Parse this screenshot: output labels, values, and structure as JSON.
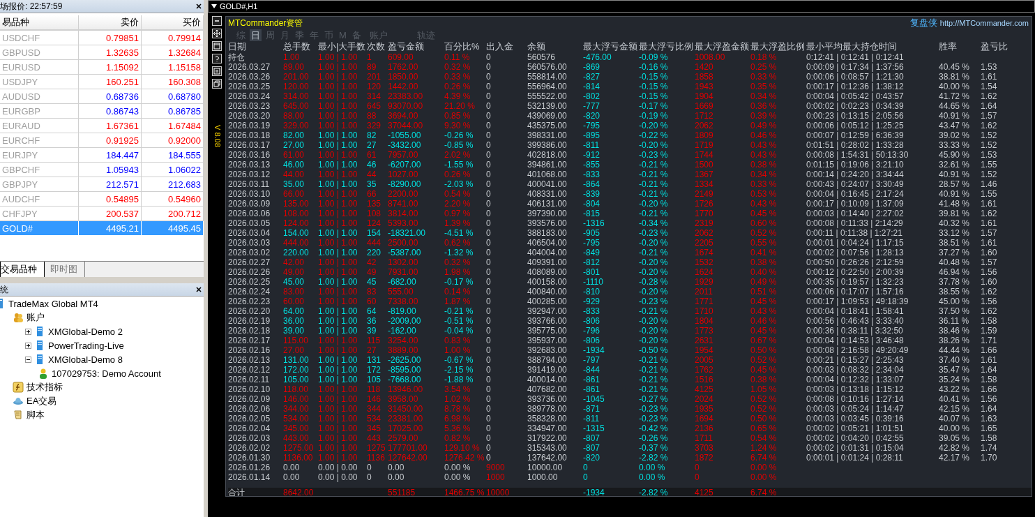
{
  "market_watch": {
    "title": "场报价: 22:57:59",
    "columns": [
      "易品种",
      "卖价",
      "买价"
    ],
    "rows": [
      {
        "symbol": "USDCHF",
        "bid": "0.79851",
        "ask": "0.79914",
        "color": "#ff0000",
        "selected": false
      },
      {
        "symbol": "GBPUSD",
        "bid": "1.32635",
        "ask": "1.32684",
        "color": "#ff0000",
        "selected": false
      },
      {
        "symbol": "EURUSD",
        "bid": "1.15092",
        "ask": "1.15158",
        "color": "#ff0000",
        "selected": false
      },
      {
        "symbol": "USDJPY",
        "bid": "160.251",
        "ask": "160.308",
        "color": "#ff0000",
        "selected": false
      },
      {
        "symbol": "AUDUSD",
        "bid": "0.68736",
        "ask": "0.68780",
        "color": "#0000ff",
        "selected": false
      },
      {
        "symbol": "EURGBP",
        "bid": "0.86743",
        "ask": "0.86785",
        "color": "#0000ff",
        "selected": false
      },
      {
        "symbol": "EURAUD",
        "bid": "1.67361",
        "ask": "1.67484",
        "color": "#ff0000",
        "selected": false
      },
      {
        "symbol": "EURCHF",
        "bid": "0.91925",
        "ask": "0.92000",
        "color": "#ff0000",
        "selected": false
      },
      {
        "symbol": "EURJPY",
        "bid": "184.447",
        "ask": "184.555",
        "color": "#0000ff",
        "selected": false
      },
      {
        "symbol": "GBPCHF",
        "bid": "1.05943",
        "ask": "1.06022",
        "color": "#0000ff",
        "selected": false
      },
      {
        "symbol": "GBPJPY",
        "bid": "212.571",
        "ask": "212.683",
        "color": "#0000ff",
        "selected": false
      },
      {
        "symbol": "AUDCHF",
        "bid": "0.54895",
        "ask": "0.54960",
        "color": "#ff0000",
        "selected": false
      },
      {
        "symbol": "CHFJPY",
        "bid": "200.537",
        "ask": "200.712",
        "color": "#ff0000",
        "selected": false
      },
      {
        "symbol": "GOLD#",
        "bid": "4495.21",
        "ask": "4495.45",
        "selected": true
      }
    ],
    "tabs": [
      {
        "label": "交易品种",
        "selected": true
      },
      {
        "label": "即时图",
        "selected": false
      }
    ]
  },
  "navigator": {
    "title": "统",
    "tree": [
      {
        "label": "TradeMax Global MT4",
        "kind": "root",
        "children": [
          {
            "label": "账户",
            "kind": "accounts",
            "children": [
              {
                "label": "XMGlobal-Demo 2",
                "kind": "server",
                "expanded": false
              },
              {
                "label": "PowerTrading-Live",
                "kind": "server",
                "expanded": false
              },
              {
                "label": "XMGlobal-Demo 8",
                "kind": "server",
                "expanded": true,
                "children": [
                  {
                    "label": "107029753: Demo Account",
                    "kind": "account"
                  }
                ]
              }
            ]
          },
          {
            "label": "技术指标",
            "kind": "indicators"
          },
          {
            "label": "EA交易",
            "kind": "experts"
          },
          {
            "label": "脚本",
            "kind": "scripts"
          }
        ]
      }
    ]
  },
  "chart_window": {
    "title": "GOLD#,H1",
    "version": "V 8.08",
    "panel": {
      "brand": "MTCommander资管",
      "link_label": "复盘侠",
      "link": "http://MTCommander.com",
      "tabs": [
        {
          "label": "综",
          "selected": false
        },
        {
          "label": "日",
          "selected": true
        },
        {
          "label": "周",
          "selected": false
        },
        {
          "label": "月",
          "selected": false
        },
        {
          "label": "季",
          "selected": false
        },
        {
          "label": "年",
          "selected": false
        },
        {
          "label": "币",
          "selected": false
        },
        {
          "label": "M",
          "selected": false
        },
        {
          "label": "备",
          "selected": false
        },
        {
          "label": "账户",
          "selected": false
        },
        {
          "label": "轨迹",
          "selected": false
        }
      ],
      "columns": [
        {
          "label": "日期",
          "kind": "plain"
        },
        {
          "label": "总手数",
          "kind": "tone"
        },
        {
          "label": "最小|大手数",
          "kind": "tone"
        },
        {
          "label": "次数",
          "kind": "tone"
        },
        {
          "label": "盈亏金额",
          "kind": "tone"
        },
        {
          "label": "百分比%",
          "kind": "tone"
        },
        {
          "label": "出入金",
          "kind": "flow"
        },
        {
          "label": "余额",
          "kind": "plain"
        },
        {
          "label": "最大浮亏金额",
          "kind": "loss"
        },
        {
          "label": "最大浮亏比例",
          "kind": "loss"
        },
        {
          "label": "最大浮盈金额",
          "kind": "gain"
        },
        {
          "label": "最大浮盈比例",
          "kind": "gain"
        },
        {
          "label": "最小平均最大持仓时间",
          "kind": "plain"
        },
        {
          "label": "胜率",
          "kind": "plain"
        },
        {
          "label": "盈亏比",
          "kind": "plain"
        }
      ],
      "rows": [
        {
          "kind": "gain",
          "cells": [
            "持仓",
            "1.00",
            "1.00 | 1.00",
            "1",
            "609.00",
            "0.11 %",
            "0",
            "560576",
            "-476.00",
            "-0.09 %",
            "1008.00",
            "0.18 %",
            "0:12:41 | 0:12:41 | 0:12:41",
            null,
            null
          ]
        },
        {
          "kind": "gain",
          "cells": [
            "2026.03.27",
            "89.00",
            "1.00 | 1.00",
            "89",
            "1762.00",
            "0.32 %",
            "0",
            "560576.00",
            "-869",
            "-0.16 %",
            "1420",
            "0.25 %",
            "0:00:09 | 0:17:34 | 1:37:56",
            "40.45 %",
            "1.53"
          ]
        },
        {
          "kind": "gain",
          "cells": [
            "2026.03.26",
            "201.00",
            "1.00 | 1.00",
            "201",
            "1850.00",
            "0.33 %",
            "0",
            "558814.00",
            "-827",
            "-0.15 %",
            "1858",
            "0.33 %",
            "0:00:06 | 0:08:57 | 1:21:30",
            "38.81 %",
            "1.61"
          ]
        },
        {
          "kind": "gain",
          "cells": [
            "2026.03.25",
            "120.00",
            "1.00 | 1.00",
            "120",
            "1442.00",
            "0.26 %",
            "0",
            "556964.00",
            "-814",
            "-0.15 %",
            "1943",
            "0.35 %",
            "0:00:17 | 0:12:36 | 1:38:12",
            "40.00 %",
            "1.54"
          ]
        },
        {
          "kind": "gain",
          "cells": [
            "2026.03.24",
            "314.00",
            "1.00 | 1.00",
            "314",
            "23383.00",
            "4.39 %",
            "0",
            "555522.00",
            "-802",
            "-0.15 %",
            "1904",
            "0.34 %",
            "0:00:04 | 0:05:42 | 0:43:57",
            "41.72 %",
            "1.62"
          ]
        },
        {
          "kind": "gain",
          "cells": [
            "2026.03.23",
            "645.00",
            "1.00 | 1.00",
            "645",
            "93070.00",
            "21.20 %",
            "0",
            "532139.00",
            "-777",
            "-0.17 %",
            "1669",
            "0.36 %",
            "0:00:02 | 0:02:23 | 0:34:39",
            "44.65 %",
            "1.64"
          ]
        },
        {
          "kind": "gain",
          "cells": [
            "2026.03.20",
            "88.00",
            "1.00 | 1.00",
            "88",
            "3694.00",
            "0.85 %",
            "0",
            "439069.00",
            "-820",
            "-0.19 %",
            "1712",
            "0.39 %",
            "0:00:23 | 0:13:15 | 2:05:56",
            "40.91 %",
            "1.57"
          ]
        },
        {
          "kind": "gain",
          "cells": [
            "2026.03.19",
            "329.00",
            "1.00 | 1.00",
            "329",
            "37044.00",
            "9.30 %",
            "0",
            "435375.00",
            "-795",
            "-0.20 %",
            "2062",
            "0.49 %",
            "0:00:06 | 0:05:12 | 1:25:25",
            "43.47 %",
            "1.62"
          ]
        },
        {
          "kind": "loss",
          "cells": [
            "2026.03.18",
            "82.00",
            "1.00 | 1.00",
            "82",
            "-1055.00",
            "-0.26 %",
            "0",
            "398331.00",
            "-895",
            "-0.22 %",
            "1809",
            "0.46 %",
            "0:00:07 | 0:12:59 | 6:36:39",
            "39.02 %",
            "1.52"
          ]
        },
        {
          "kind": "loss",
          "cells": [
            "2026.03.17",
            "27.00",
            "1.00 | 1.00",
            "27",
            "-3432.00",
            "-0.85 %",
            "0",
            "399386.00",
            "-811",
            "-0.20 %",
            "1719",
            "0.43 %",
            "0:01:51 | 0:28:02 | 1:33:28",
            "33.33 %",
            "1.52"
          ]
        },
        {
          "kind": "gain",
          "cells": [
            "2026.03.16",
            "61.00",
            "1.00 | 1.00",
            "61",
            "7957.00",
            "2.02 %",
            "0",
            "402818.00",
            "-912",
            "-0.23 %",
            "1744",
            "0.43 %",
            "0:00:08 | 1:54:31 | 50:13:30",
            "45.90 %",
            "1.53"
          ]
        },
        {
          "kind": "loss",
          "cells": [
            "2026.03.13",
            "46.00",
            "1.00 | 1.00",
            "46",
            "-6207.00",
            "-1.55 %",
            "0",
            "394861.00",
            "-855",
            "-0.21 %",
            "1500",
            "0.38 %",
            "0:01:15 | 0:19:06 | 3:21:10",
            "32.61 %",
            "1.55"
          ]
        },
        {
          "kind": "gain",
          "cells": [
            "2026.03.12",
            "44.00",
            "1.00 | 1.00",
            "44",
            "1027.00",
            "0.26 %",
            "0",
            "401068.00",
            "-833",
            "-0.21 %",
            "1367",
            "0.34 %",
            "0:00:14 | 0:24:20 | 3:34:44",
            "40.91 %",
            "1.52"
          ]
        },
        {
          "kind": "loss",
          "cells": [
            "2026.03.11",
            "35.00",
            "1.00 | 1.00",
            "35",
            "-8290.00",
            "-2.03 %",
            "0",
            "400041.00",
            "-864",
            "-0.21 %",
            "1334",
            "0.33 %",
            "0:00:43 | 0:24:07 | 3:30:49",
            "28.57 %",
            "1.46"
          ]
        },
        {
          "kind": "gain",
          "cells": [
            "2026.03.10",
            "66.00",
            "1.00 | 1.00",
            "66",
            "2200.00",
            "0.54 %",
            "0",
            "408331.00",
            "-839",
            "-0.21 %",
            "2149",
            "0.53 %",
            "0:00:04 | 0:16:45 | 2:17:24",
            "40.91 %",
            "1.55"
          ]
        },
        {
          "kind": "gain",
          "cells": [
            "2026.03.09",
            "135.00",
            "1.00 | 1.00",
            "135",
            "8741.00",
            "2.20 %",
            "0",
            "406131.00",
            "-804",
            "-0.20 %",
            "1726",
            "0.43 %",
            "0:00:17 | 0:10:09 | 1:37:09",
            "41.48 %",
            "1.61"
          ]
        },
        {
          "kind": "gain",
          "cells": [
            "2026.03.06",
            "108.00",
            "1.00 | 1.00",
            "108",
            "3814.00",
            "0.97 %",
            "0",
            "397390.00",
            "-815",
            "-0.21 %",
            "1770",
            "0.45 %",
            "0:00:03 | 0:14:40 | 2:27:02",
            "39.81 %",
            "1.62"
          ]
        },
        {
          "kind": "gain",
          "cells": [
            "2026.03.05",
            "124.00",
            "1.00 | 1.00",
            "124",
            "5393.00",
            "1.39 %",
            "0",
            "393576.00",
            "-1316",
            "-0.34 %",
            "2319",
            "0.60 %",
            "0:00:08 | 0:11:33 | 2:14:29",
            "40.32 %",
            "1.61"
          ]
        },
        {
          "kind": "loss",
          "cells": [
            "2026.03.04",
            "154.00",
            "1.00 | 1.00",
            "154",
            "-18321.00",
            "-4.51 %",
            "0",
            "388183.00",
            "-905",
            "-0.23 %",
            "2062",
            "0.52 %",
            "0:00:11 | 0:11:38 | 1:27:21",
            "33.12 %",
            "1.57"
          ]
        },
        {
          "kind": "gain",
          "cells": [
            "2026.03.03",
            "444.00",
            "1.00 | 1.00",
            "444",
            "2500.00",
            "0.62 %",
            "0",
            "406504.00",
            "-795",
            "-0.20 %",
            "2205",
            "0.55 %",
            "0:00:01 | 0:04:24 | 1:17:15",
            "38.51 %",
            "1.61"
          ]
        },
        {
          "kind": "loss",
          "cells": [
            "2026.03.02",
            "220.00",
            "1.00 | 1.00",
            "220",
            "-5387.00",
            "-1.32 %",
            "0",
            "404004.00",
            "-849",
            "-0.21 %",
            "1674",
            "0.41 %",
            "0:00:02 | 0:07:56 | 1:28:13",
            "37.27 %",
            "1.60"
          ]
        },
        {
          "kind": "gain",
          "cells": [
            "2026.02.27",
            "42.00",
            "1.00 | 1.00",
            "42",
            "1302.00",
            "0.32 %",
            "0",
            "409391.00",
            "-812",
            "-0.20 %",
            "1532",
            "0.38 %",
            "0:00:50 | 0:26:26 | 2:12:59",
            "40.48 %",
            "1.57"
          ]
        },
        {
          "kind": "gain",
          "cells": [
            "2026.02.26",
            "49.00",
            "1.00 | 1.00",
            "49",
            "7931.00",
            "1.98 %",
            "0",
            "408089.00",
            "-801",
            "-0.20 %",
            "1624",
            "0.40 %",
            "0:00:12 | 0:22:50 | 2:00:39",
            "46.94 %",
            "1.56"
          ]
        },
        {
          "kind": "loss",
          "cells": [
            "2026.02.25",
            "45.00",
            "1.00 | 1.00",
            "45",
            "-682.00",
            "-0.17 %",
            "0",
            "400158.00",
            "-1110",
            "-0.28 %",
            "1929",
            "0.49 %",
            "0:00:35 | 0:19:57 | 1:32:23",
            "37.78 %",
            "1.60"
          ]
        },
        {
          "kind": "gain",
          "cells": [
            "2026.02.24",
            "83.00",
            "1.00 | 1.00",
            "83",
            "555.00",
            "0.14 %",
            "0",
            "400840.00",
            "-810",
            "-0.20 %",
            "2011",
            "0.51 %",
            "0:00:06 | 0:17:07 | 1:57:16",
            "38.55 %",
            "1.62"
          ]
        },
        {
          "kind": "gain",
          "cells": [
            "2026.02.23",
            "60.00",
            "1.00 | 1.00",
            "60",
            "7338.00",
            "1.87 %",
            "0",
            "400285.00",
            "-929",
            "-0.23 %",
            "1771",
            "0.45 %",
            "0:00:17 | 1:09:53 | 49:18:39",
            "45.00 %",
            "1.56"
          ]
        },
        {
          "kind": "loss",
          "cells": [
            "2026.02.20",
            "64.00",
            "1.00 | 1.00",
            "64",
            "-819.00",
            "-0.21 %",
            "0",
            "392947.00",
            "-833",
            "-0.21 %",
            "1710",
            "0.43 %",
            "0:00:04 | 0:18:41 | 1:58:41",
            "37.50 %",
            "1.62"
          ]
        },
        {
          "kind": "loss",
          "cells": [
            "2026.02.19",
            "36.00",
            "1.00 | 1.00",
            "36",
            "-2009.00",
            "-0.51 %",
            "0",
            "393766.00",
            "-806",
            "-0.20 %",
            "1804",
            "0.46 %",
            "0:00:56 | 0:46:43 | 3:33:40",
            "36.11 %",
            "1.58"
          ]
        },
        {
          "kind": "loss",
          "cells": [
            "2026.02.18",
            "39.00",
            "1.00 | 1.00",
            "39",
            "-162.00",
            "-0.04 %",
            "0",
            "395775.00",
            "-796",
            "-0.20 %",
            "1773",
            "0.45 %",
            "0:00:36 | 0:38:11 | 3:32:50",
            "38.46 %",
            "1.59"
          ]
        },
        {
          "kind": "gain",
          "cells": [
            "2026.02.17",
            "115.00",
            "1.00 | 1.00",
            "115",
            "3254.00",
            "0.83 %",
            "0",
            "395937.00",
            "-806",
            "-0.20 %",
            "2631",
            "0.67 %",
            "0:00:04 | 0:14:53 | 3:46:48",
            "38.26 %",
            "1.71"
          ]
        },
        {
          "kind": "gain",
          "cells": [
            "2026.02.16",
            "27.00",
            "1.00 | 1.00",
            "27",
            "3889.00",
            "1.00 %",
            "0",
            "392683.00",
            "-1934",
            "-0.50 %",
            "1954",
            "0.50 %",
            "0:00:08 | 2:16:58 | 49:20:49",
            "44.44 %",
            "1.66"
          ]
        },
        {
          "kind": "loss",
          "cells": [
            "2026.02.13",
            "131.00",
            "1.00 | 1.00",
            "131",
            "-2625.00",
            "-0.67 %",
            "0",
            "388794.00",
            "-797",
            "-0.21 %",
            "2005",
            "0.52 %",
            "0:00:21 | 0:15:27 | 2:25:43",
            "37.40 %",
            "1.61"
          ]
        },
        {
          "kind": "loss",
          "cells": [
            "2026.02.12",
            "172.00",
            "1.00 | 1.00",
            "172",
            "-8595.00",
            "-2.15 %",
            "0",
            "391419.00",
            "-844",
            "-0.21 %",
            "1762",
            "0.45 %",
            "0:00:03 | 0:08:32 | 2:34:04",
            "35.47 %",
            "1.64"
          ]
        },
        {
          "kind": "loss",
          "cells": [
            "2026.02.11",
            "105.00",
            "1.00 | 1.00",
            "105",
            "-7668.00",
            "-1.88 %",
            "0",
            "400014.00",
            "-861",
            "-0.21 %",
            "1516",
            "0.38 %",
            "0:00:04 | 0:12:32 | 1:33:07",
            "35.24 %",
            "1.58"
          ]
        },
        {
          "kind": "gain",
          "cells": [
            "2026.02.10",
            "118.00",
            "1.00 | 1.00",
            "118",
            "13946.00",
            "3.54 %",
            "0",
            "407682.00",
            "-861",
            "-0.21 %",
            "4125",
            "1.05 %",
            "0:00:03 | 0:13:18 | 1:15:12",
            "43.22 %",
            "1.66"
          ]
        },
        {
          "kind": "gain",
          "cells": [
            "2026.02.09",
            "146.00",
            "1.00 | 1.00",
            "146",
            "3958.00",
            "1.02 %",
            "0",
            "393736.00",
            "-1045",
            "-0.27 %",
            "2024",
            "0.52 %",
            "0:00:08 | 0:10:16 | 1:27:14",
            "40.41 %",
            "1.56"
          ]
        },
        {
          "kind": "gain",
          "cells": [
            "2026.02.06",
            "344.00",
            "1.00 | 1.00",
            "344",
            "31450.00",
            "8.78 %",
            "0",
            "389778.00",
            "-871",
            "-0.23 %",
            "1935",
            "0.52 %",
            "0:00:03 | 0:05:24 | 1:14:47",
            "42.15 %",
            "1.64"
          ]
        },
        {
          "kind": "gain",
          "cells": [
            "2026.02.05",
            "534.00",
            "1.00 | 1.00",
            "534",
            "23381.00",
            "6.98 %",
            "0",
            "358328.00",
            "-811",
            "-0.23 %",
            "1694",
            "0.50 %",
            "0:00:03 | 0:03:45 | 0:39:16",
            "40.07 %",
            "1.63"
          ]
        },
        {
          "kind": "gain",
          "cells": [
            "2026.02.04",
            "345.00",
            "1.00 | 1.00",
            "345",
            "17025.00",
            "5.36 %",
            "0",
            "334947.00",
            "-1315",
            "-0.42 %",
            "2136",
            "0.65 %",
            "0:00:02 | 0:05:21 | 1:01:51",
            "40.00 %",
            "1.65"
          ]
        },
        {
          "kind": "gain",
          "cells": [
            "2026.02.03",
            "443.00",
            "1.00 | 1.00",
            "443",
            "2579.00",
            "0.82 %",
            "0",
            "317922.00",
            "-807",
            "-0.26 %",
            "1711",
            "0.54 %",
            "0:00:02 | 0:04:20 | 0:42:55",
            "39.05 %",
            "1.58"
          ]
        },
        {
          "kind": "gain",
          "cells": [
            "2026.02.02",
            "1275.00",
            "1.00 | 1.00",
            "1275",
            "177701.00",
            "129.10 %",
            "0",
            "315343.00",
            "-807",
            "-0.37 %",
            "3703",
            "1.24 %",
            "0:00:02 | 0:01:31 | 0:15:04",
            "42.82 %",
            "1.74"
          ]
        },
        {
          "kind": "gain",
          "cells": [
            "2026.01.30",
            "1136.00",
            "1.00 | 1.00",
            "1136",
            "127642.00",
            "1276.42 %",
            "0",
            "137642.00",
            "-820",
            "-2.82 %",
            "1872",
            "6.74 %",
            "0:00:01 | 0:01:24 | 0:28:11",
            "42.17 %",
            "1.70"
          ]
        },
        {
          "kind": "deposit",
          "cells": [
            "2026.01.26",
            "0.00",
            "0.00 | 0.00",
            "0",
            "0.00",
            "0.00 %",
            "9000",
            "10000.00",
            "0",
            "0.00 %",
            "0",
            "0.00 %",
            null,
            null,
            null
          ]
        },
        {
          "kind": "deposit",
          "cells": [
            "2026.01.14",
            "0.00",
            "0.00 | 0.00",
            "0",
            "0.00",
            "0.00 %",
            "1000",
            "1000.00",
            "0",
            "0.00 %",
            "0",
            "0.00 %",
            null,
            null,
            null
          ]
        }
      ],
      "total": {
        "kind": "total",
        "cells": [
          "合计",
          "8642.00",
          null,
          null,
          "551185",
          "1466.75 %",
          "10000",
          null,
          "-1934",
          "-2.82 %",
          "4125",
          "6.74 %",
          null,
          null,
          null
        ]
      }
    }
  }
}
